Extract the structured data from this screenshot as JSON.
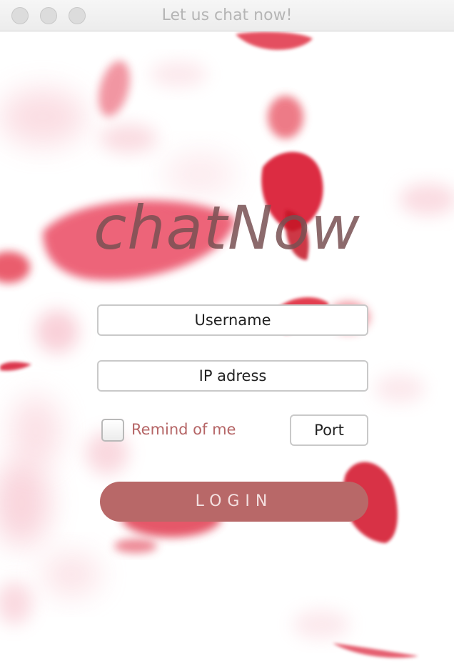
{
  "window": {
    "title": "Let us chat now!"
  },
  "logo": {
    "text": "chatNow"
  },
  "form": {
    "username_placeholder": "Username",
    "ip_placeholder": "IP adress",
    "remind_label": "Remind of me",
    "remind_checked": false,
    "port_placeholder": "Port",
    "login_label": "LOGIN"
  },
  "colors": {
    "accent": "#b86868",
    "remind_text": "#b56566",
    "logo_text": "#785052",
    "petal": "#e0293f"
  },
  "icons": [
    "close-icon",
    "minimize-icon",
    "zoom-icon"
  ]
}
